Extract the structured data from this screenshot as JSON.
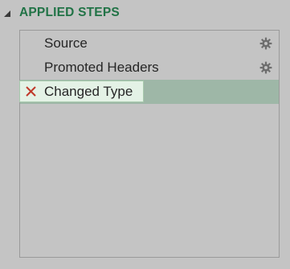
{
  "header": {
    "title": "APPLIED STEPS"
  },
  "steps": [
    {
      "label": "Source",
      "has_settings": true,
      "selected": false
    },
    {
      "label": "Promoted Headers",
      "has_settings": true,
      "selected": false
    },
    {
      "label": "Changed Type",
      "has_settings": false,
      "selected": true
    }
  ],
  "icons": {
    "collapse": "collapse-triangle-icon",
    "settings": "gear-icon",
    "delete": "delete-x-icon"
  },
  "colors": {
    "title": "#217346",
    "panel_background": "#c4c4c4",
    "selected_row": "#9eb7a7",
    "selected_label_background": "#e4f2e6",
    "delete_icon": "#c0392b"
  }
}
